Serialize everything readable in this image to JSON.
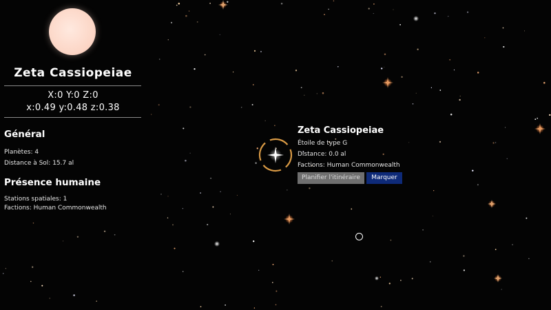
{
  "star": {
    "name": "Zeta Cassiopeiae",
    "grid_coords": "X:0 Y:0 Z:0",
    "norm_coords": "x:0.49 y:0.48 z:0.38",
    "disc_color": "#fcd6c6"
  },
  "general": {
    "title": "Général",
    "planets": "Planètes: 4",
    "distance_sol": "Distance à Sol: 15.7 al"
  },
  "human_presence": {
    "title": "Présence humaine",
    "stations": "Stations spatiales: 1",
    "factions": "Factions: Human Commonwealth"
  },
  "popup": {
    "title": "Zeta Cassiopeiae",
    "type": "Étoile de type G",
    "distance": "Distance: 0.0 al",
    "factions": "Factions: Human Commonwealth",
    "plan_button": "Planifier l'itinéraire",
    "mark_button": "Marquer"
  },
  "colors": {
    "background": "#040404",
    "selector_ring": "#d99a45",
    "mark_button": "#0e2a78",
    "plan_button": "#6f6f6f"
  }
}
